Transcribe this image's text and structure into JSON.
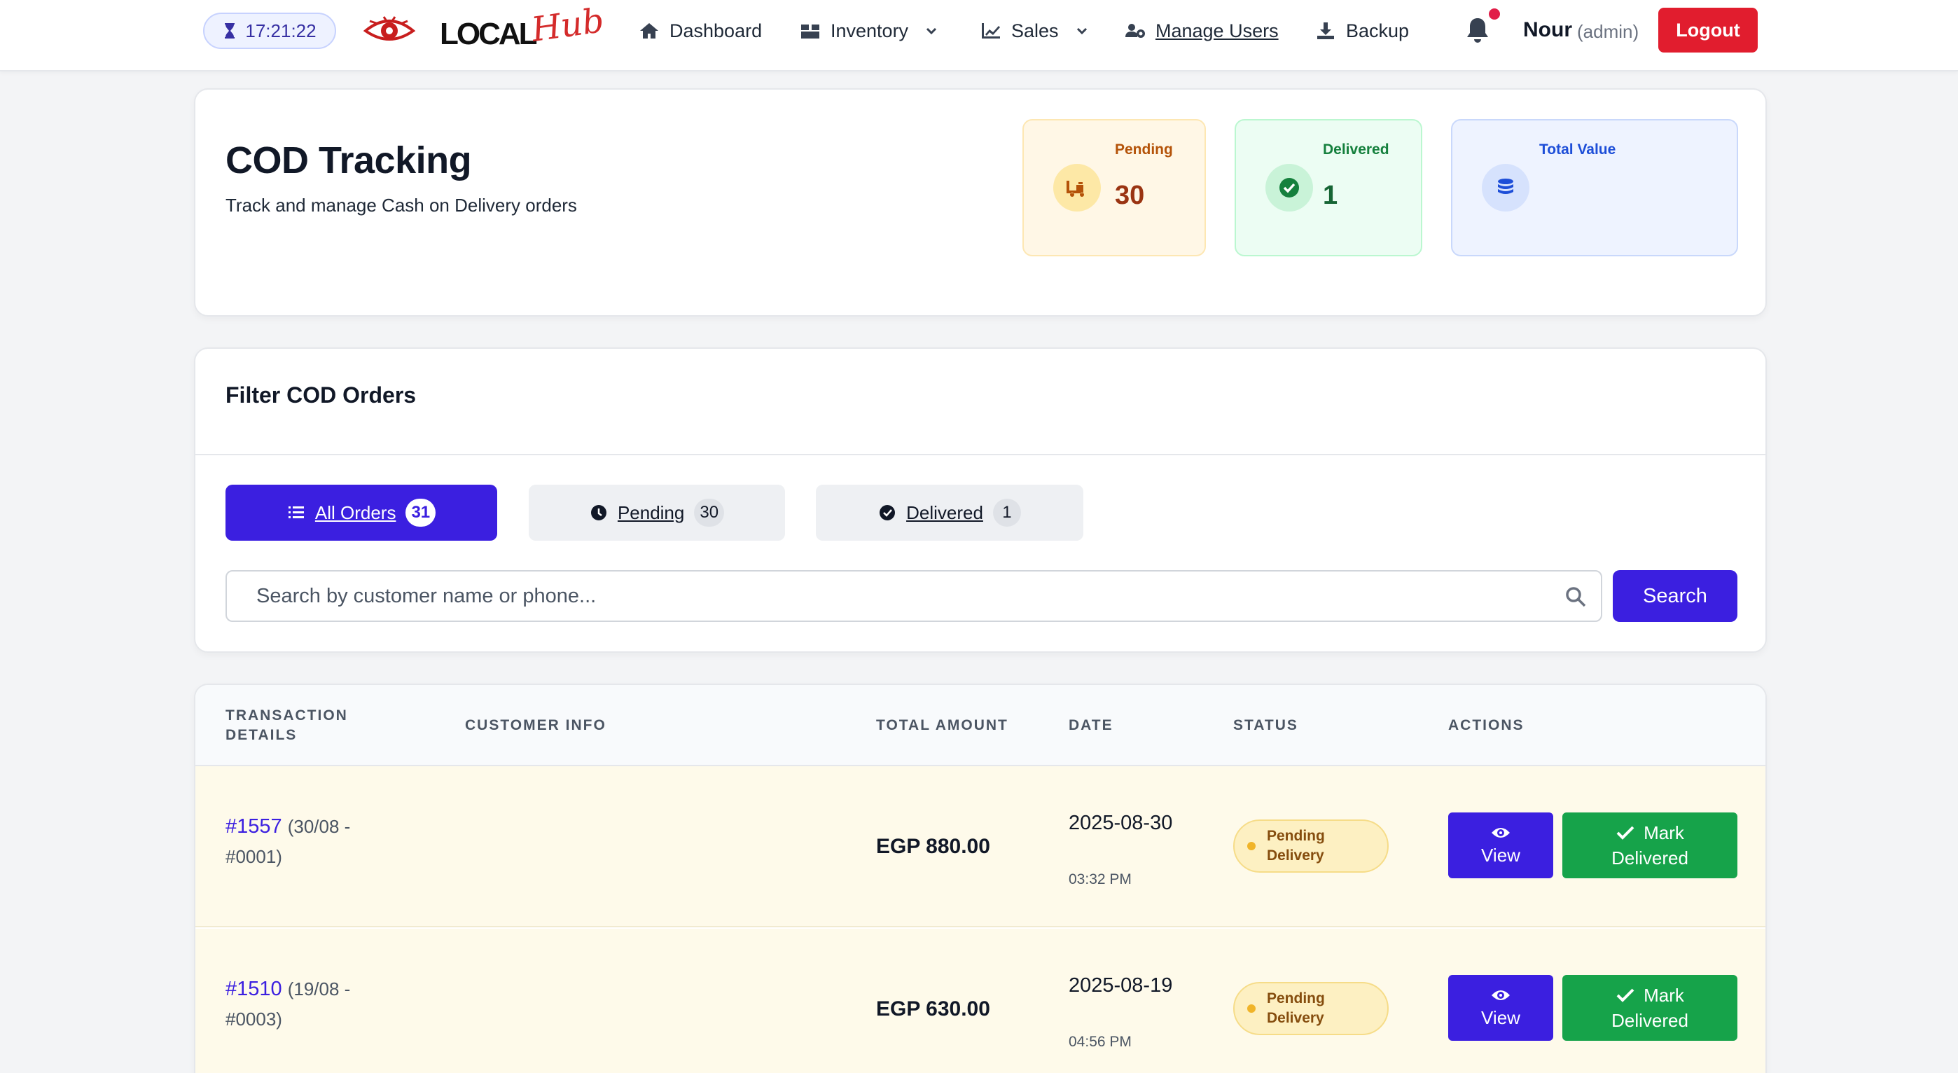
{
  "clock": {
    "time": "17:21:22",
    "icon": "hourglass-icon"
  },
  "brand": {
    "name_part1": "LOCAL",
    "name_part2": "Hub",
    "logo_icon": "eye-logo-icon"
  },
  "nav": [
    {
      "label": "Dashboard",
      "icon": "home-icon"
    },
    {
      "label": "Inventory",
      "icon": "boxes-icon",
      "dropdown": true
    },
    {
      "label": "Sales",
      "icon": "chart-line-icon",
      "dropdown": true
    },
    {
      "label": "Manage Users",
      "icon": "users-cog-icon"
    },
    {
      "label": "Backup",
      "icon": "download-icon"
    }
  ],
  "user": {
    "name": "Nour",
    "role": "(admin)",
    "logout_label": "Logout",
    "has_notification": true
  },
  "header": {
    "title": "COD Tracking",
    "subtitle": "Track and manage Cash on Delivery orders",
    "stats": {
      "pending": {
        "label": "Pending",
        "value": "30",
        "icon": "truck-loading-icon"
      },
      "delivered": {
        "label": "Delivered",
        "value": "1",
        "icon": "check-circle-icon"
      },
      "total": {
        "label": "Total Value",
        "value": "",
        "icon": "coins-icon"
      }
    }
  },
  "filter": {
    "title": "Filter COD Orders",
    "tabs": [
      {
        "label": "All Orders",
        "count": "31",
        "icon": "list-icon",
        "active": true
      },
      {
        "label": "Pending",
        "count": "30",
        "icon": "clock-icon",
        "active": false
      },
      {
        "label": "Delivered",
        "count": "1",
        "icon": "check-circle-icon",
        "active": false
      }
    ],
    "search_placeholder": "Search by customer name or phone...",
    "search_value": "",
    "search_button": "Search"
  },
  "table": {
    "columns": [
      "TRANSACTION DETAILS",
      "CUSTOMER INFO",
      "TOTAL AMOUNT",
      "DATE",
      "STATUS",
      "ACTIONS"
    ],
    "rows": [
      {
        "id": "#1557",
        "ref_line1": "(30/08 -",
        "ref_line2": "#0001)",
        "customer": "",
        "amount": "EGP 880.00",
        "date": "2025-08-30",
        "time": "03:32 PM",
        "status": "Pending Delivery",
        "view_label": "View",
        "mark_label_1": "Mark",
        "mark_label_2": "Delivered"
      },
      {
        "id": "#1510",
        "ref_line1": "(19/08 -",
        "ref_line2": "#0003)",
        "customer": "",
        "amount": "EGP 630.00",
        "date": "2025-08-19",
        "time": "04:56 PM",
        "status": "Pending Delivery",
        "view_label": "View",
        "mark_label_1": "Mark",
        "mark_label_2": "Delivered"
      }
    ]
  },
  "colors": {
    "primary": "#3b1fe0",
    "danger": "#e11d2e",
    "success": "#16a34a",
    "pending_bg": "#fefaea"
  }
}
